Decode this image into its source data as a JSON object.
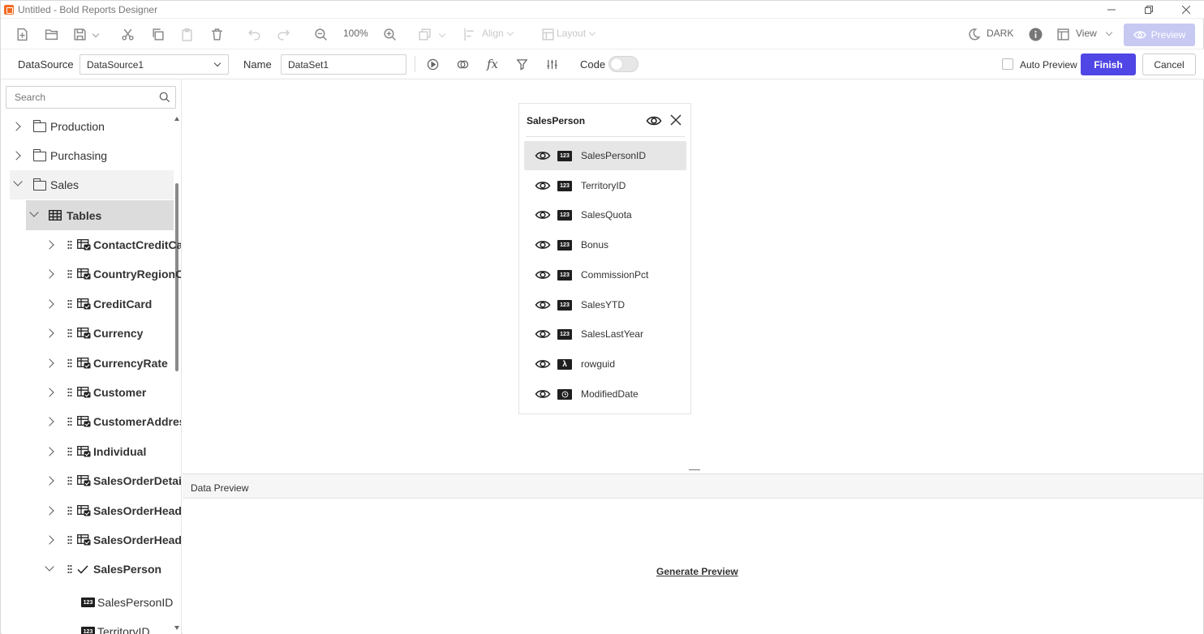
{
  "window": {
    "title": "Untitled - Bold Reports Designer"
  },
  "toolbar": {
    "zoom": "100%",
    "align_label": "Align",
    "layout_label": "Layout",
    "theme_label": "DARK",
    "view_label": "View",
    "preview_label": "Preview"
  },
  "dataset": {
    "datasource_label": "DataSource",
    "datasource_value": "DataSource1",
    "name_label": "Name",
    "name_value": "DataSet1",
    "code_label": "Code",
    "auto_preview_label": "Auto Preview",
    "finish_label": "Finish",
    "cancel_label": "Cancel"
  },
  "search": {
    "placeholder": "Search"
  },
  "tree": {
    "folders": [
      {
        "label": "Production"
      },
      {
        "label": "Purchasing"
      },
      {
        "label": "Sales"
      }
    ],
    "tables_label": "Tables",
    "tables": [
      {
        "label": "ContactCreditCa"
      },
      {
        "label": "CountryRegionC"
      },
      {
        "label": "CreditCard"
      },
      {
        "label": "Currency"
      },
      {
        "label": "CurrencyRate"
      },
      {
        "label": "Customer"
      },
      {
        "label": "CustomerAddres"
      },
      {
        "label": "Individual"
      },
      {
        "label": "SalesOrderDetai"
      },
      {
        "label": "SalesOrderHead"
      },
      {
        "label": "SalesOrderHead"
      },
      {
        "label": "SalesPerson"
      }
    ],
    "children": [
      {
        "label": "SalesPersonID",
        "type": "123"
      },
      {
        "label": "TerritoryID",
        "type": "123"
      }
    ]
  },
  "table_card": {
    "title": "SalesPerson",
    "columns": [
      {
        "name": "SalesPersonID",
        "type": "123"
      },
      {
        "name": "TerritoryID",
        "type": "123"
      },
      {
        "name": "SalesQuota",
        "type": "123"
      },
      {
        "name": "Bonus",
        "type": "123"
      },
      {
        "name": "CommissionPct",
        "type": "123"
      },
      {
        "name": "SalesYTD",
        "type": "123"
      },
      {
        "name": "SalesLastYear",
        "type": "123"
      },
      {
        "name": "rowguid",
        "type": "λ"
      },
      {
        "name": "ModifiedDate",
        "type": "clock"
      }
    ]
  },
  "data_preview": {
    "title": "Data Preview",
    "generate_label": "Generate Preview"
  },
  "colors": {
    "accent": "#4f46e5",
    "preview_disabled": "#c7c9f3",
    "selected_row": "#e6e6e6"
  }
}
